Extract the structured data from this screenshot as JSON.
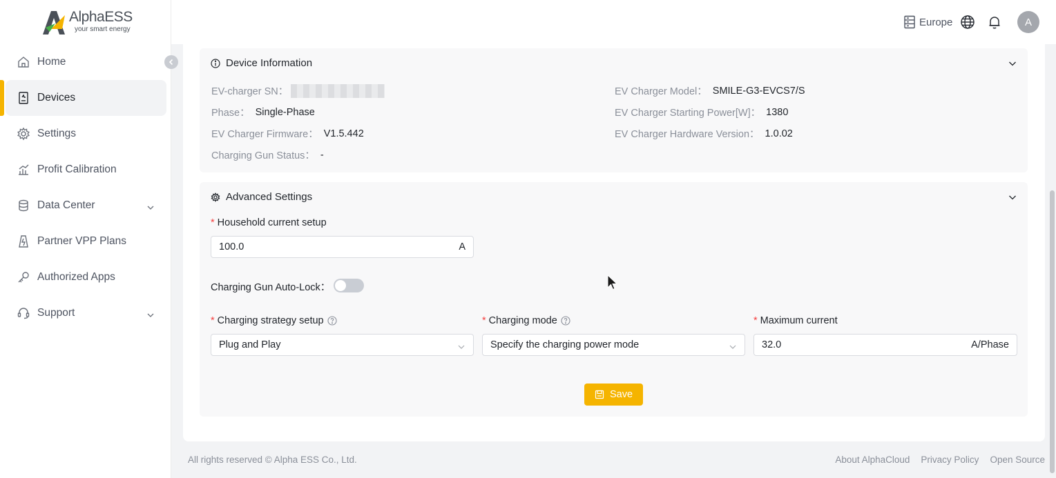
{
  "brand": {
    "name": "AlphaESS",
    "tagline": "your smart energy"
  },
  "sidebar": {
    "items": [
      {
        "label": "Home",
        "icon": "home-icon"
      },
      {
        "label": "Devices",
        "icon": "device-icon",
        "active": true
      },
      {
        "label": "Settings",
        "icon": "gear-icon"
      },
      {
        "label": "Profit Calibration",
        "icon": "chart-icon"
      },
      {
        "label": "Data Center",
        "icon": "database-icon",
        "expandable": true
      },
      {
        "label": "Partner VPP Plans",
        "icon": "vpp-icon"
      },
      {
        "label": "Authorized Apps",
        "icon": "key-icon"
      },
      {
        "label": "Support",
        "icon": "support-icon",
        "expandable": true
      }
    ]
  },
  "header": {
    "region": "Europe",
    "avatar_initial": "A"
  },
  "device_info": {
    "title": "Device Information",
    "fields": {
      "sn_label": "EV-charger SN：",
      "model_label": "EV Charger Model：",
      "model_value": "SMILE-G3-EVCS7/S",
      "phase_label": "Phase：",
      "phase_value": "Single-Phase",
      "starting_power_label": "EV Charger Starting Power[W]：",
      "starting_power_value": "1380",
      "firmware_label": "EV Charger Firmware：",
      "firmware_value": "V1.5.442",
      "hardware_label": "EV Charger Hardware Version：",
      "hardware_value": "1.0.02",
      "gun_status_label": "Charging Gun Status：",
      "gun_status_value": "-"
    }
  },
  "advanced_settings": {
    "title": "Advanced Settings",
    "household_current": {
      "label": "Household current setup",
      "value": "100.0",
      "unit": "A"
    },
    "auto_lock": {
      "label": "Charging Gun Auto-Lock：",
      "enabled": false
    },
    "charging_strategy": {
      "label": "Charging strategy setup",
      "value": "Plug and Play"
    },
    "charging_mode": {
      "label": "Charging mode",
      "value": "Specify the charging power mode"
    },
    "max_current": {
      "label": "Maximum current",
      "value": "32.0",
      "unit": "A/Phase"
    },
    "save_label": "Save"
  },
  "footer": {
    "copyright": "All rights reserved © Alpha ESS Co., Ltd.",
    "links": [
      "About AlphaCloud",
      "Privacy Policy",
      "Open Source"
    ]
  },
  "colors": {
    "accent": "#f5b400",
    "required": "#f53f3f"
  }
}
